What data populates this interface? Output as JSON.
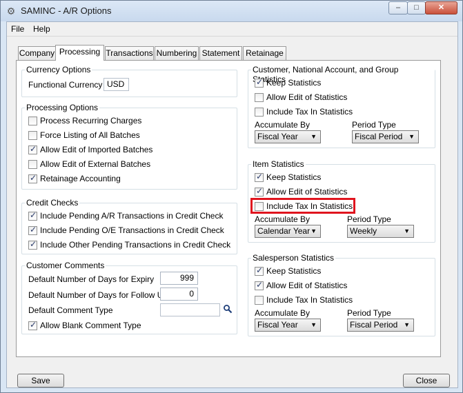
{
  "window": {
    "title": "SAMINC - A/R Options",
    "minimize_glyph": "–",
    "maximize_glyph": "□",
    "close_glyph": "✕"
  },
  "menu": {
    "file": "File",
    "help": "Help"
  },
  "tabs": [
    "Company",
    "Processing",
    "Transactions",
    "Numbering",
    "Statement",
    "Retainage"
  ],
  "active_tab": "Processing",
  "currency": {
    "title": "Currency Options",
    "label": "Functional Currency",
    "value": "USD"
  },
  "processing": {
    "title": "Processing Options",
    "items": [
      {
        "label": "Process Recurring Charges",
        "checked": false
      },
      {
        "label": "Force Listing of All Batches",
        "checked": false
      },
      {
        "label": "Allow Edit of Imported Batches",
        "checked": true
      },
      {
        "label": "Allow Edit of External Batches",
        "checked": false
      },
      {
        "label": "Retainage Accounting",
        "checked": true
      }
    ]
  },
  "credit": {
    "title": "Credit Checks",
    "items": [
      {
        "label": "Include Pending A/R Transactions in Credit Check",
        "checked": true
      },
      {
        "label": "Include Pending O/E Transactions in Credit Check",
        "checked": true
      },
      {
        "label": "Include Other Pending Transactions in Credit Check",
        "checked": true
      }
    ]
  },
  "comments": {
    "title": "Customer Comments",
    "expiry_label": "Default Number of Days for Expiry",
    "expiry_value": "999",
    "followup_label": "Default Number of Days for Follow Up",
    "followup_value": "0",
    "type_label": "Default Comment Type",
    "type_value": "",
    "allow_blank_label": "Allow Blank Comment Type",
    "allow_blank_checked": true
  },
  "customer_stats": {
    "title": "Customer, National Account, and Group Statistics",
    "keep": "Keep Statistics",
    "keep_checked": true,
    "allow_edit": "Allow Edit of Statistics",
    "allow_edit_checked": false,
    "include_tax": "Include Tax In Statistics",
    "include_tax_checked": false,
    "accumulate_label": "Accumulate By",
    "accumulate_value": "Fiscal Year",
    "period_label": "Period Type",
    "period_value": "Fiscal Period"
  },
  "item_stats": {
    "title": "Item Statistics",
    "keep": "Keep Statistics",
    "keep_checked": true,
    "allow_edit": "Allow Edit of Statistics",
    "allow_edit_checked": true,
    "include_tax": "Include Tax In Statistics",
    "include_tax_checked": false,
    "accumulate_label": "Accumulate By",
    "accumulate_value": "Calendar Year",
    "period_label": "Period Type",
    "period_value": "Weekly"
  },
  "sales_stats": {
    "title": "Salesperson Statistics",
    "keep": "Keep Statistics",
    "keep_checked": true,
    "allow_edit": "Allow Edit of Statistics",
    "allow_edit_checked": true,
    "include_tax": "Include Tax In Statistics",
    "include_tax_checked": false,
    "accumulate_label": "Accumulate By",
    "accumulate_value": "Fiscal Year",
    "period_label": "Period Type",
    "period_value": "Fiscal Period"
  },
  "buttons": {
    "save": "Save",
    "close": "Close"
  },
  "highlight_color": "#e0141e"
}
